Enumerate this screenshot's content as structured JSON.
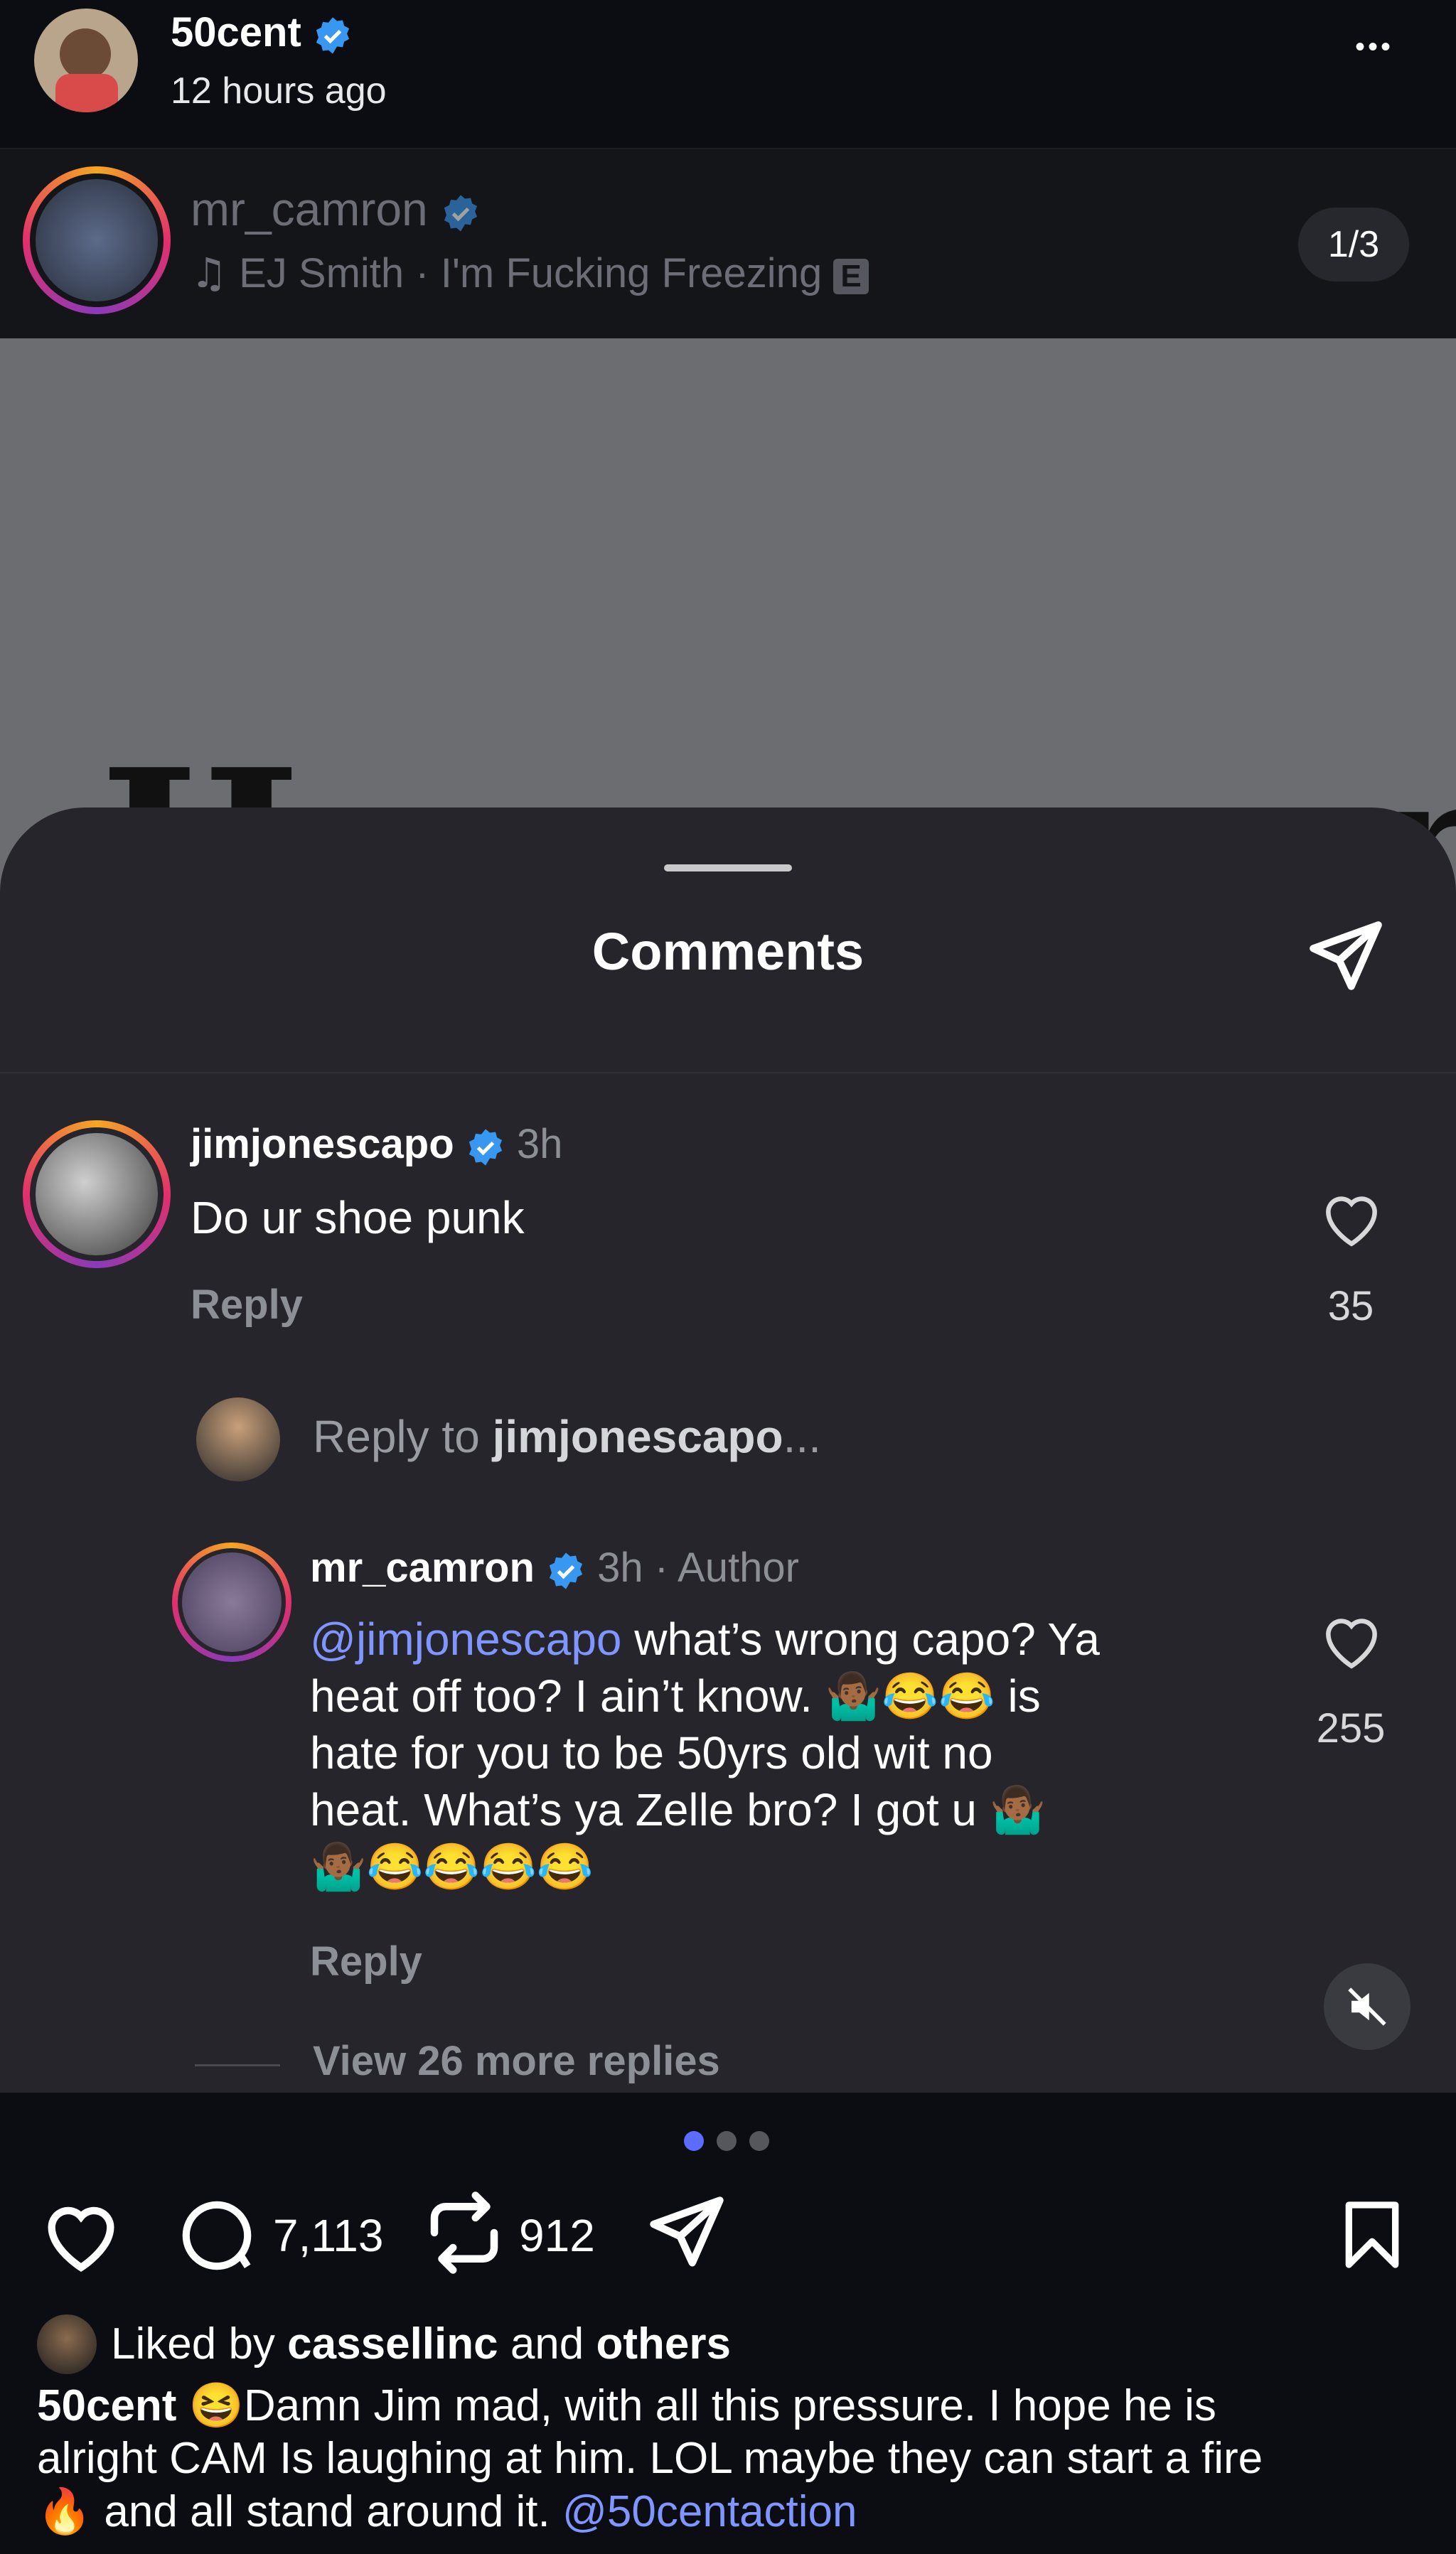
{
  "post": {
    "username": "50cent",
    "time": "12 hours ago",
    "more": "•••"
  },
  "reel": {
    "username": "mr_camron",
    "music": "EJ Smith · I'm Fucking Freezing",
    "explicit": "E",
    "counter": "1/3",
    "bg_text": "How u worried"
  },
  "sheet": {
    "title": "Comments",
    "comments": [
      {
        "username": "jimjonescapo",
        "time": "3h",
        "text": "Do ur shoe punk",
        "reply": "Reply",
        "likes": "35"
      }
    ],
    "reply_prompt_prefix": "Reply to ",
    "reply_prompt_user": "jimjonescapo",
    "reply_prompt_suffix": "...",
    "reply": {
      "username": "mr_camron",
      "meta": "3h · Author",
      "mention": "@jimjonescapo",
      "line1_rest": " what’s wrong capo? Ya",
      "line2": "heat off too? I ain’t know. 🤷🏾‍♂️😂😂 is",
      "line3": "hate for you to be 50yrs old wit no",
      "line4": "heat. What’s ya Zelle bro? I got u 🤷🏾‍♂️",
      "line5": "🤷🏾‍♂️😂😂😂😂",
      "reply": "Reply",
      "likes": "255"
    },
    "view_more": "View 26 more replies"
  },
  "actions": {
    "comments_count": "7,113",
    "reposts_count": "912"
  },
  "likes": {
    "prefix": "Liked by ",
    "user": "cassellinc",
    "and": " and ",
    "others": "others"
  },
  "caption": {
    "username": "50cent",
    "line1": " 😆Damn Jim mad, with all this pressure. I hope he is",
    "line2": "alright CAM Is laughing at him. LOL maybe they can start a fire",
    "line3_emoji": "🔥",
    "line3": " and all stand around it. ",
    "mention": "@50centaction"
  },
  "colors": {
    "accent": "#3897f0",
    "link": "#7f95ff",
    "sheet_bg": "#25252b",
    "page_bg": "#0b0d12"
  }
}
